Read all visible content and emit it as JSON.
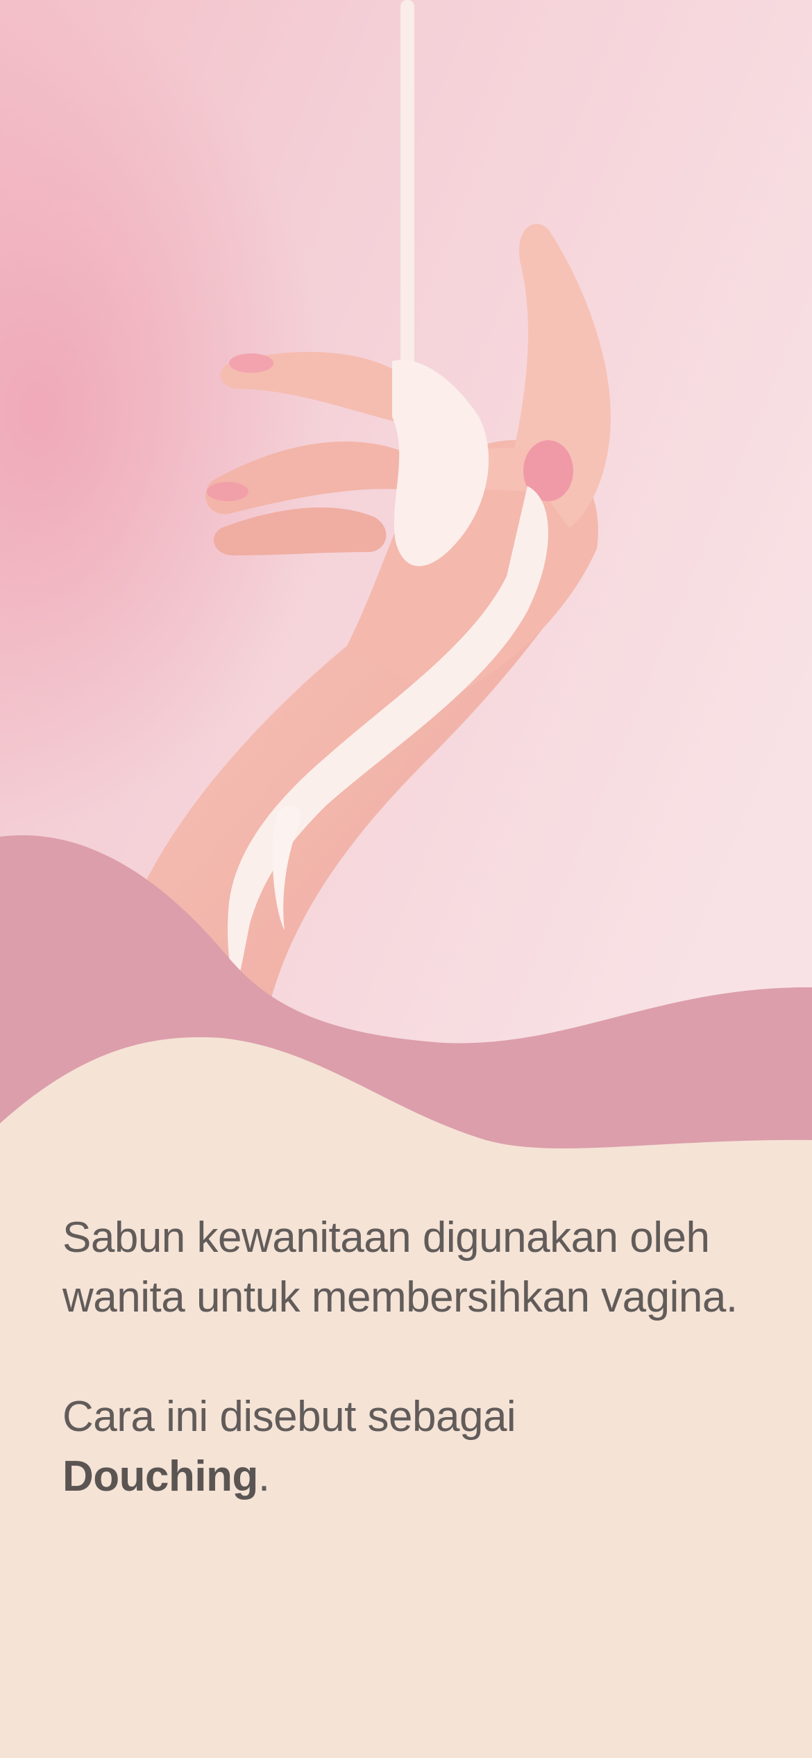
{
  "hero": {
    "image_icon": "hand-with-lotion-photo"
  },
  "colors": {
    "hero_bg": "#f6d8dc",
    "wave_top": "#dc9eab",
    "content_bg": "#f5e3d6",
    "text": "#615c5a"
  },
  "content": {
    "paragraph_1": "Sabun kewanitaan digunakan oleh wanita untuk membersihkan vagina.",
    "paragraph_2_prefix": "Cara ini disebut sebagai",
    "paragraph_2_term": "Douching",
    "paragraph_2_suffix": "."
  }
}
